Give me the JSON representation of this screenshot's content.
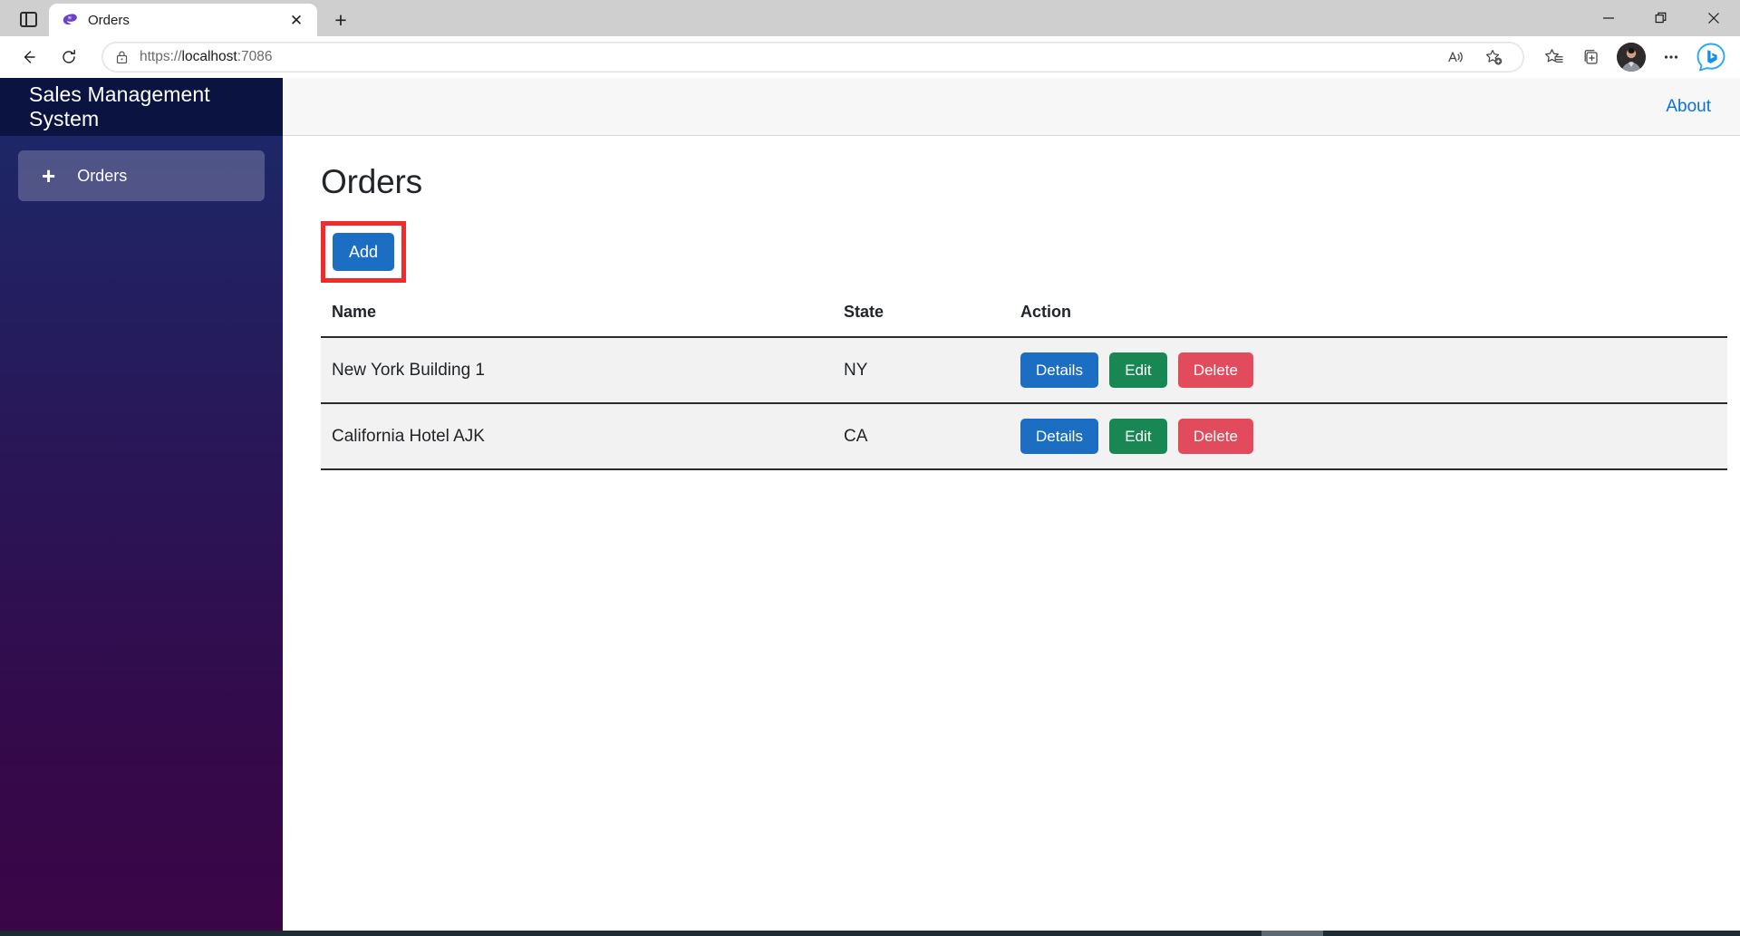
{
  "browser": {
    "tab": {
      "title": "Orders",
      "favicon_icon": "blazor-logo-icon",
      "close_icon": "✕"
    },
    "new_tab_label": "+",
    "tab_actions_icon": "split-screen-icon",
    "window_controls": {
      "minimize": "—",
      "restore": "❐",
      "close": "✕"
    },
    "nav": {
      "back_icon": "back-arrow-icon",
      "reload_icon": "reload-icon"
    },
    "omnibox": {
      "lock_icon": "lock-icon",
      "url_scheme": "https://",
      "url_host": "localhost",
      "url_port": ":7086",
      "url_full": "https://localhost:7086",
      "read_aloud_icon": "read-aloud-icon",
      "add_favorite_icon": "add-favorite-star-icon"
    },
    "toolbar": {
      "favorites_icon": "favorites-star-list-icon",
      "collections_icon": "collections-icon",
      "profile_icon": "profile-avatar",
      "settings_icon": "ellipsis-more-icon",
      "copilot_icon": "bing-copilot-icon"
    }
  },
  "app": {
    "brand_title": "Sales Management System",
    "sidebar": {
      "items": [
        {
          "label": "Orders",
          "icon": "plus-icon",
          "active": true
        }
      ]
    },
    "header": {
      "about_label": "About"
    },
    "main": {
      "page_title": "Orders",
      "add_button_label": "Add",
      "add_button_highlighted": true,
      "highlight_color": "#ef2b2b",
      "table": {
        "columns": [
          "Name",
          "State",
          "Action"
        ],
        "rows": [
          {
            "name": "New York Building 1",
            "state": "NY",
            "actions": [
              "Details",
              "Edit",
              "Delete"
            ]
          },
          {
            "name": "California Hotel AJK",
            "state": "CA",
            "actions": [
              "Details",
              "Edit",
              "Delete"
            ]
          }
        ],
        "action_labels": {
          "details": "Details",
          "edit": "Edit",
          "delete": "Delete"
        }
      }
    },
    "colors": {
      "brand_bar": "#0b1440",
      "sidebar_top": "#1b2a6b",
      "sidebar_bottom": "#3b0546",
      "primary": "#1b6ec2",
      "success": "#198754",
      "danger": "#e24b5c",
      "link": "#0a72d1"
    }
  }
}
